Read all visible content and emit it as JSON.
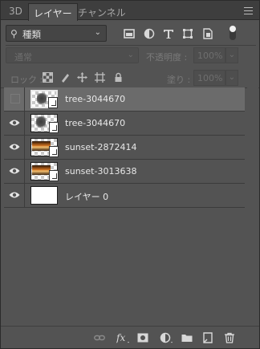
{
  "tabs": [
    {
      "label": "3D"
    },
    {
      "label": "レイヤー",
      "active": true
    },
    {
      "label": "チャンネル"
    }
  ],
  "filter": {
    "kind_label": "種類",
    "icons": [
      "image-filter-icon",
      "adjustment-filter-icon",
      "type-filter-icon",
      "shape-filter-icon",
      "smart-object-filter-icon"
    ],
    "toggle_on": true
  },
  "blend": {
    "mode": "通常",
    "opacity_label": "不透明度 :",
    "opacity_value": "100%"
  },
  "lock": {
    "label": "ロック :",
    "fill_label": "塗り :",
    "fill_value": "100%"
  },
  "layers": [
    {
      "name": "tree-3044670",
      "visible": false,
      "selected": true,
      "thumb": "tree"
    },
    {
      "name": "tree-3044670",
      "visible": true,
      "selected": false,
      "thumb": "tree"
    },
    {
      "name": "sunset-2872414",
      "visible": true,
      "selected": false,
      "thumb": "sunset"
    },
    {
      "name": "sunset-3013638",
      "visible": true,
      "selected": false,
      "thumb": "sunset"
    },
    {
      "name": "レイヤー 0",
      "visible": true,
      "selected": false,
      "thumb": "white"
    }
  ],
  "bottom_icons": [
    "link-icon",
    "fx-icon",
    "mask-icon",
    "adjustment-icon",
    "group-folder-icon",
    "new-layer-icon",
    "trash-icon"
  ],
  "colors": {
    "panel": "#535353",
    "selected_row": "#6b6b6b",
    "text": "#e8e8e8"
  }
}
